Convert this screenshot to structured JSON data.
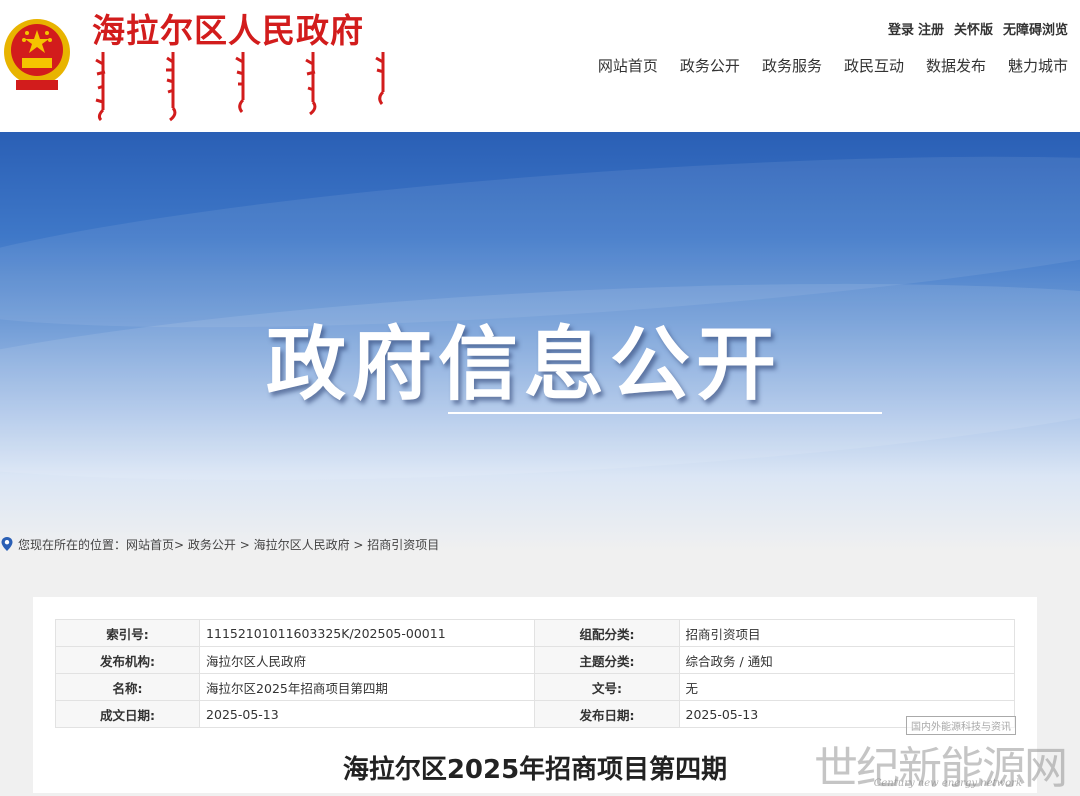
{
  "header": {
    "site_title": "海拉尔区人民政府",
    "top_links": [
      "登录",
      "注册",
      "关怀版",
      "无障碍浏览"
    ],
    "nav": [
      "网站首页",
      "政务公开",
      "政务服务",
      "政民互动",
      "数据发布",
      "魅力城市"
    ]
  },
  "banner": {
    "title": "政府信息公开"
  },
  "breadcrumb": {
    "prefix": "您现在所在的位置：",
    "items": [
      "网站首页>",
      " 政务公开 ",
      "> 海拉尔区人民政府 ",
      "> 招商引资项目"
    ]
  },
  "meta": {
    "rows": [
      {
        "k1": "索引号:",
        "v1": "11152101011603325K/202505-00011",
        "k2": "组配分类:",
        "v2": "招商引资项目"
      },
      {
        "k1": "发布机构:",
        "v1": "海拉尔区人民政府",
        "k2": "主题分类:",
        "v2": "综合政务 / 通知"
      },
      {
        "k1": "名称:",
        "v1": "海拉尔区2025年招商项目第四期",
        "k2": "文号:",
        "v2": "无"
      },
      {
        "k1": "成文日期:",
        "v1": "2025-05-13",
        "k2": "发布日期:",
        "v2": "2025-05-13"
      }
    ]
  },
  "article": {
    "title": "海拉尔区2025年招商项目第四期"
  },
  "watermark": {
    "box": "国内外能源科技与资讯",
    "big": "世纪新能源网",
    "small": "Century new energy network"
  },
  "colors": {
    "brand_red": "#d21c1c",
    "banner_blue": "#2a5fb5"
  }
}
